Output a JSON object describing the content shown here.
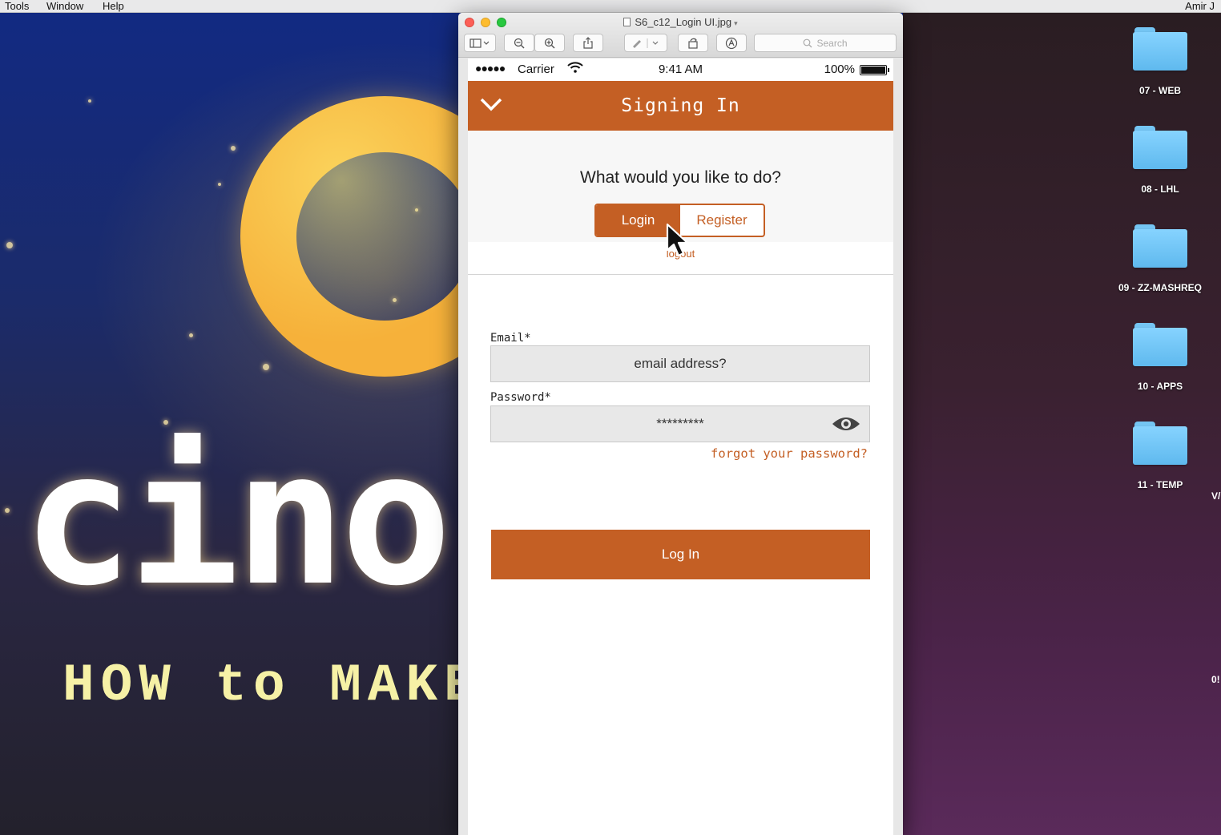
{
  "menubar": {
    "items": [
      "Tools",
      "Window",
      "Help"
    ],
    "user": "Amir J"
  },
  "desktop": {
    "wallpaper_text": {
      "word": "cino",
      "tagline": "HOW to MAKE"
    },
    "folders": [
      {
        "label": "07 - WEB"
      },
      {
        "label": "08 - LHL"
      },
      {
        "label": "09 - ZZ-MASHREQ"
      },
      {
        "label": "10 - APPS"
      },
      {
        "label": "11 - TEMP"
      }
    ],
    "edge_labels": [
      "V/",
      "0!"
    ]
  },
  "window": {
    "title": "S6_c12_Login UI.jpg",
    "search_placeholder": "Search"
  },
  "phone": {
    "status": {
      "carrier": "Carrier",
      "time": "9:41 AM",
      "battery": "100%"
    },
    "header_title": "Signing In",
    "prompt": "What would you like to do?",
    "segments": {
      "login": "Login",
      "register": "Register"
    },
    "logout_link": "logout",
    "email": {
      "label": "Email*",
      "placeholder": "email address?"
    },
    "password": {
      "label": "Password*",
      "value": "*********"
    },
    "forgot_link": "forgot your password?",
    "submit_label": "Log In"
  },
  "colors": {
    "accent": "#c45f24",
    "folder": "#6fc6f8"
  }
}
